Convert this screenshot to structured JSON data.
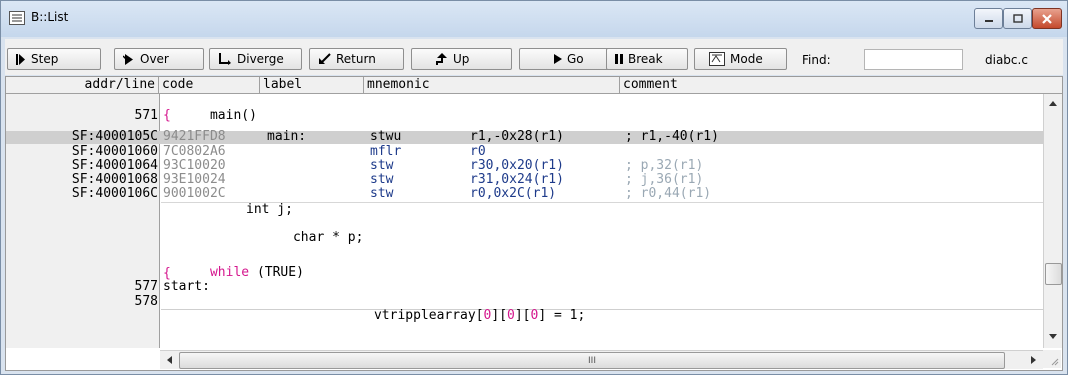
{
  "window": {
    "title": "B::List"
  },
  "toolbar": {
    "step": "Step",
    "over": "Over",
    "diverge": "Diverge",
    "return": "Return",
    "up": "Up",
    "go": "Go",
    "break": "Break",
    "mode": "Mode",
    "find_label": "Find:",
    "find_value": "",
    "file": "diabc.c"
  },
  "columns": {
    "addr_line": "addr/line",
    "code": "code",
    "label": "label",
    "mnemonic": "mnemonic",
    "comment": "comment"
  },
  "rows": {
    "r1": {
      "src": "main()"
    },
    "r2": {
      "line": "571",
      "src": "{"
    },
    "r3": {
      "addr": "SF:4000105C",
      "code": "9421FFD8",
      "label": "main:",
      "mnemonic": "stwu",
      "operands": "r1,-0x28(r1)",
      "comment": "; r1,-40(r1)"
    },
    "r4": {
      "addr": "SF:40001060",
      "code": "7C0802A6",
      "mnemonic": "mflr",
      "operands": "r0"
    },
    "r5": {
      "addr": "SF:40001064",
      "code": "93C10020",
      "mnemonic": "stw",
      "operands": "r30,0x20(r1)",
      "comment": "; p,32(r1)"
    },
    "r6": {
      "addr": "SF:40001068",
      "code": "93E10024",
      "mnemonic": "stw",
      "operands": "r31,0x24(r1)",
      "comment": "; j,36(r1)"
    },
    "r7": {
      "addr": "SF:4000106C",
      "code": "9001002C",
      "mnemonic": "stw",
      "operands": "r0,0x2C(r1)",
      "comment": "; r0,44(r1)"
    },
    "r8": {
      "src": "int j;"
    },
    "r9": {
      "src_a": "char",
      "src_b": "* p;"
    },
    "r10": {
      "kw": "while",
      "src": "(TRUE)"
    },
    "r11": {
      "src": "{"
    },
    "r12": {
      "line": "577",
      "src": "start:"
    },
    "r13": {
      "line": "578",
      "src_a": "vtripplearray[",
      "i0": "0",
      "b1": "][",
      "i1": "0",
      "b2": "][",
      "i2": "0",
      "b3": "]",
      "src_b": " = 1;"
    }
  },
  "scroll": {
    "hthumb": "III"
  },
  "colors": {
    "accent_pink": "#d5178e",
    "highlight_row": "#cfcfcf"
  }
}
